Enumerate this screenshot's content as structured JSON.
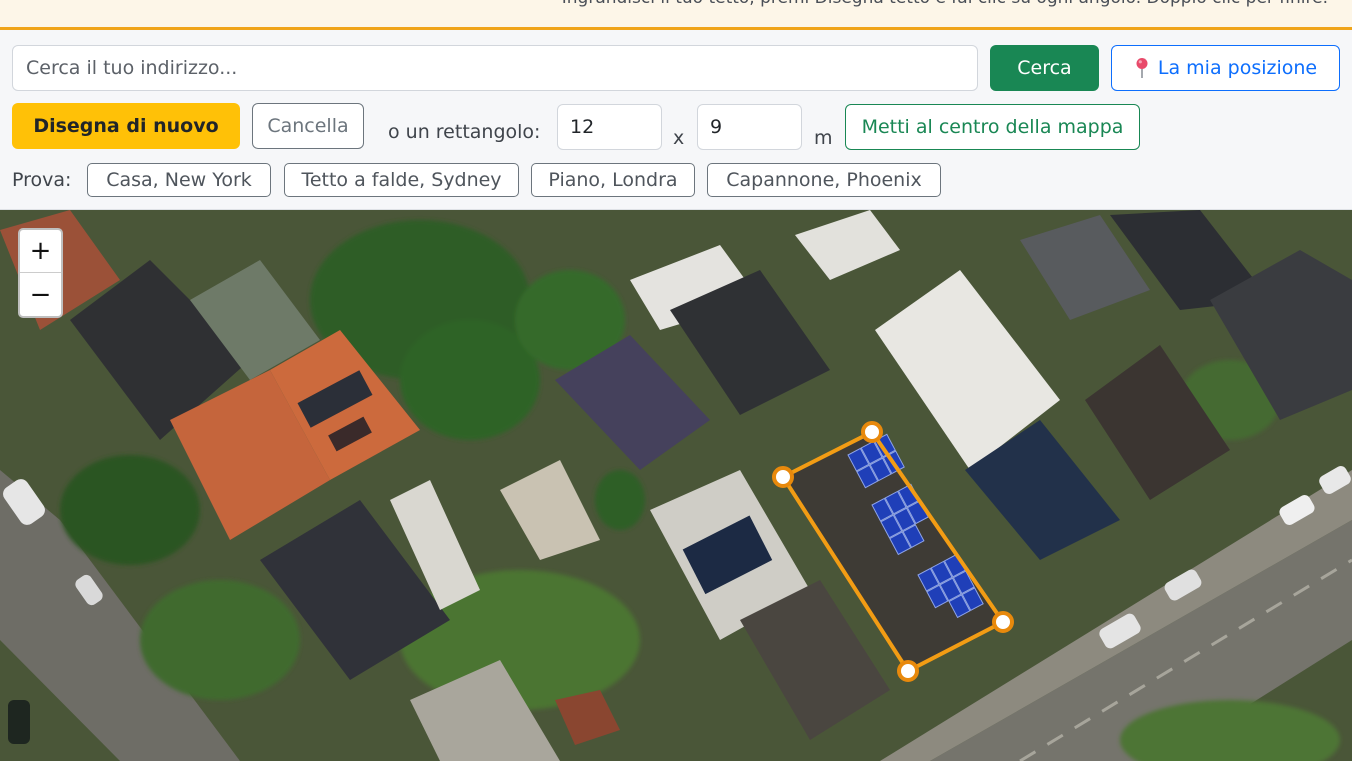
{
  "hint": {
    "text": "Ingrandisci il tuo tetto, premi Disegna tetto e fai clic su ogni angolo. Doppio clic per finire."
  },
  "search": {
    "placeholder": "Cerca il tuo indirizzo...",
    "button_label": "Cerca",
    "locate_label": "La mia posizione",
    "locate_icon": "map-pin-icon"
  },
  "draw": {
    "redraw_label": "Disegna di nuovo",
    "cancel_label": "Cancella",
    "rectangle_label": "o un rettangolo:",
    "width_value": "12",
    "times_label": "x",
    "height_value": "9",
    "unit_label": "m",
    "center_label": "Metti al centro della mappa"
  },
  "examples": {
    "label": "Prova:",
    "items": [
      "Casa, New York",
      "Tetto a falde, Sydney",
      "Piano, Londra",
      "Capannone, Phoenix"
    ]
  },
  "map": {
    "zoom_in": "+",
    "zoom_out": "−",
    "outline_color": "#f29c14",
    "panel_color": "#1f3fb8"
  },
  "colors": {
    "accent_green": "#198754",
    "accent_blue": "#0d6efd",
    "accent_yellow": "#ffc107",
    "hint_border": "#f0a418"
  }
}
